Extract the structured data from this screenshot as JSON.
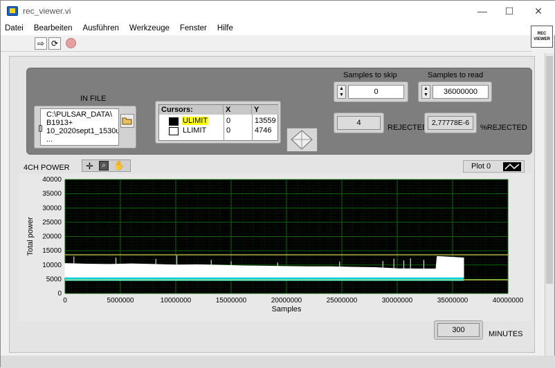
{
  "window": {
    "title": "rec_viewer.vi",
    "minimize": "—",
    "maximize": "☐",
    "close": "✕"
  },
  "menu": [
    "Datei",
    "Bearbeiten",
    "Ausführen",
    "Werkzeuge",
    "Fenster",
    "Hilfe"
  ],
  "toolbar": {
    "run_icon": "⇨",
    "run_cont_icon": "⟳",
    "rec_icon_text_1": "REC",
    "rec_icon_text_2": "VIEWER"
  },
  "infile": {
    "label": "IN FILE",
    "path_lines": [
      "C:\\PULSAR_DATA\\",
      "B1913+",
      "10_2020sept1_1530u",
      "..."
    ],
    "browse_icon": "folder-icon"
  },
  "cursors": {
    "headers": [
      "Cursors:",
      "X",
      "Y"
    ],
    "rows": [
      {
        "name": "ULIMIT",
        "x": "0",
        "y": "13559",
        "highlight": "#ffff00"
      },
      {
        "name": "LLIMIT",
        "x": "0",
        "y": "4746"
      }
    ]
  },
  "skip": {
    "label": "Samples to skip",
    "value": "0"
  },
  "read": {
    "label": "Samples to read",
    "value": "36000000"
  },
  "rejected": {
    "value": "4",
    "label": "REJECTED"
  },
  "pct_rejected": {
    "value": "2,77778E-6",
    "label": "%REJECTED"
  },
  "graph": {
    "label": "4CH POWER",
    "plot_legend": "Plot 0"
  },
  "minutes": {
    "value": "300",
    "label": "MINUTES"
  },
  "colors": {
    "plot_bg": "#000000",
    "grid": "#0b6b0b",
    "cursor_line": "#e8e858",
    "trace_main": "#ffffff",
    "trace_low": "#00cfe0"
  },
  "chart_data": {
    "type": "line",
    "xlabel": "Samples",
    "ylabel": "Total power",
    "xlim": [
      0,
      40000000
    ],
    "ylim": [
      0,
      40000
    ],
    "x_ticks": [
      "0",
      "5000000",
      "10000000",
      "15000000",
      "20000000",
      "25000000",
      "30000000",
      "35000000",
      "40000000"
    ],
    "y_ticks": [
      "0",
      "5000",
      "10000",
      "15000",
      "20000",
      "25000",
      "30000",
      "35000",
      "40000"
    ],
    "grid": true,
    "cursor_lines": [
      {
        "name": "ULIMIT",
        "y": 13559
      },
      {
        "name": "LLIMIT",
        "y": 4746
      }
    ],
    "series": [
      {
        "name": "Plot 0",
        "x_end": 36000000,
        "upper_band": [
          [
            0,
            10500
          ],
          [
            2000000,
            10300
          ],
          [
            4000000,
            10200
          ],
          [
            6000000,
            10400
          ],
          [
            8000000,
            10200
          ],
          [
            10000000,
            10000
          ],
          [
            12000000,
            10100
          ],
          [
            14000000,
            9900
          ],
          [
            16000000,
            9700
          ],
          [
            18000000,
            9600
          ],
          [
            20000000,
            9500
          ],
          [
            22000000,
            9400
          ],
          [
            24000000,
            9400
          ],
          [
            26000000,
            9200
          ],
          [
            28000000,
            9100
          ],
          [
            30000000,
            8700
          ],
          [
            32000000,
            8600
          ],
          [
            33500000,
            8600
          ],
          [
            33600000,
            13000
          ],
          [
            36000000,
            12500
          ]
        ],
        "lower_band": [
          [
            0,
            5600
          ],
          [
            36000000,
            5400
          ]
        ]
      }
    ]
  }
}
